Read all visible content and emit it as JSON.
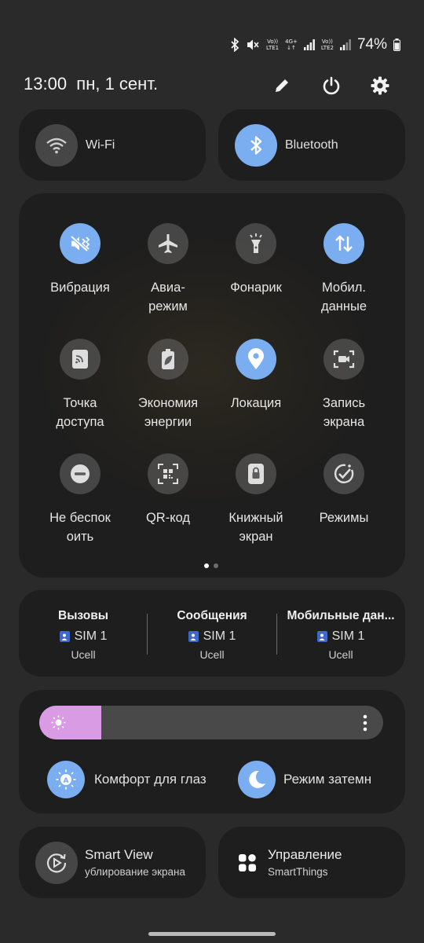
{
  "status_bar": {
    "volte1_top": "Vo))",
    "volte1_bottom": "LTE1",
    "network": "4G+",
    "volte2_top": "Vo))",
    "volte2_bottom": "LTE2",
    "battery": "74%"
  },
  "header": {
    "time": "13:00",
    "date": "пн, 1 сент.",
    "icons": [
      "pencil-icon",
      "power-icon",
      "gear-icon"
    ]
  },
  "top_tiles": [
    {
      "label": "Wi-Fi",
      "active": false,
      "icon": "wifi-icon"
    },
    {
      "label": "Bluetooth",
      "active": true,
      "icon": "bluetooth-icon"
    }
  ],
  "grid_tiles": [
    {
      "label1": "Вибрация",
      "label2": "",
      "active": true,
      "icon": "vibrate-icon"
    },
    {
      "label1": "Авиа-",
      "label2": "режим",
      "active": false,
      "icon": "airplane-icon"
    },
    {
      "label1": "Фонарик",
      "label2": "",
      "active": false,
      "icon": "flashlight-icon"
    },
    {
      "label1": "Мобил.",
      "label2": "данные",
      "active": true,
      "icon": "mobile-data-icon"
    },
    {
      "label1": "Точка",
      "label2": "доступа",
      "active": false,
      "icon": "hotspot-icon"
    },
    {
      "label1": "Экономия",
      "label2": "энергии",
      "active": false,
      "icon": "battery-saver-icon"
    },
    {
      "label1": "Локация",
      "label2": "",
      "active": true,
      "icon": "location-icon"
    },
    {
      "label1": "Запись",
      "label2": "экрана",
      "active": false,
      "icon": "screen-record-icon"
    },
    {
      "label1": "Не беспок",
      "label2": "оить",
      "active": false,
      "icon": "do-not-disturb-icon"
    },
    {
      "label1": "QR-код",
      "label2": "",
      "active": false,
      "icon": "qr-code-icon"
    },
    {
      "label1": "Книжный",
      "label2": "экран",
      "active": false,
      "icon": "portrait-lock-icon"
    },
    {
      "label1": "Режимы",
      "label2": "",
      "active": false,
      "icon": "modes-icon"
    }
  ],
  "page_indicator": {
    "current": 1,
    "total": 2
  },
  "sim": [
    {
      "title": "Вызовы",
      "sim": "SIM 1",
      "carrier": "Ucell"
    },
    {
      "title": "Сообщения",
      "sim": "SIM 1",
      "carrier": "Ucell"
    },
    {
      "title": "Мобильные дан...",
      "sim": "SIM 1",
      "carrier": "Ucell"
    }
  ],
  "brightness": {
    "level": 0.18,
    "fill_color": "#d99be3"
  },
  "display_modes": [
    {
      "label": "Комфорт для глаз",
      "icon": "eye-comfort-icon"
    },
    {
      "label": "Режим затемн",
      "icon": "dark-mode-icon"
    }
  ],
  "bottom_tiles": [
    {
      "title": "Smart View",
      "subtitle": "ублирование экрана",
      "icon": "smart-view-icon"
    },
    {
      "title": "Управление",
      "subtitle": "SmartThings",
      "icon": "smartthings-icon"
    }
  ],
  "colors": {
    "accent": "#7aaef0",
    "tile_off": "#5a5a5a"
  }
}
